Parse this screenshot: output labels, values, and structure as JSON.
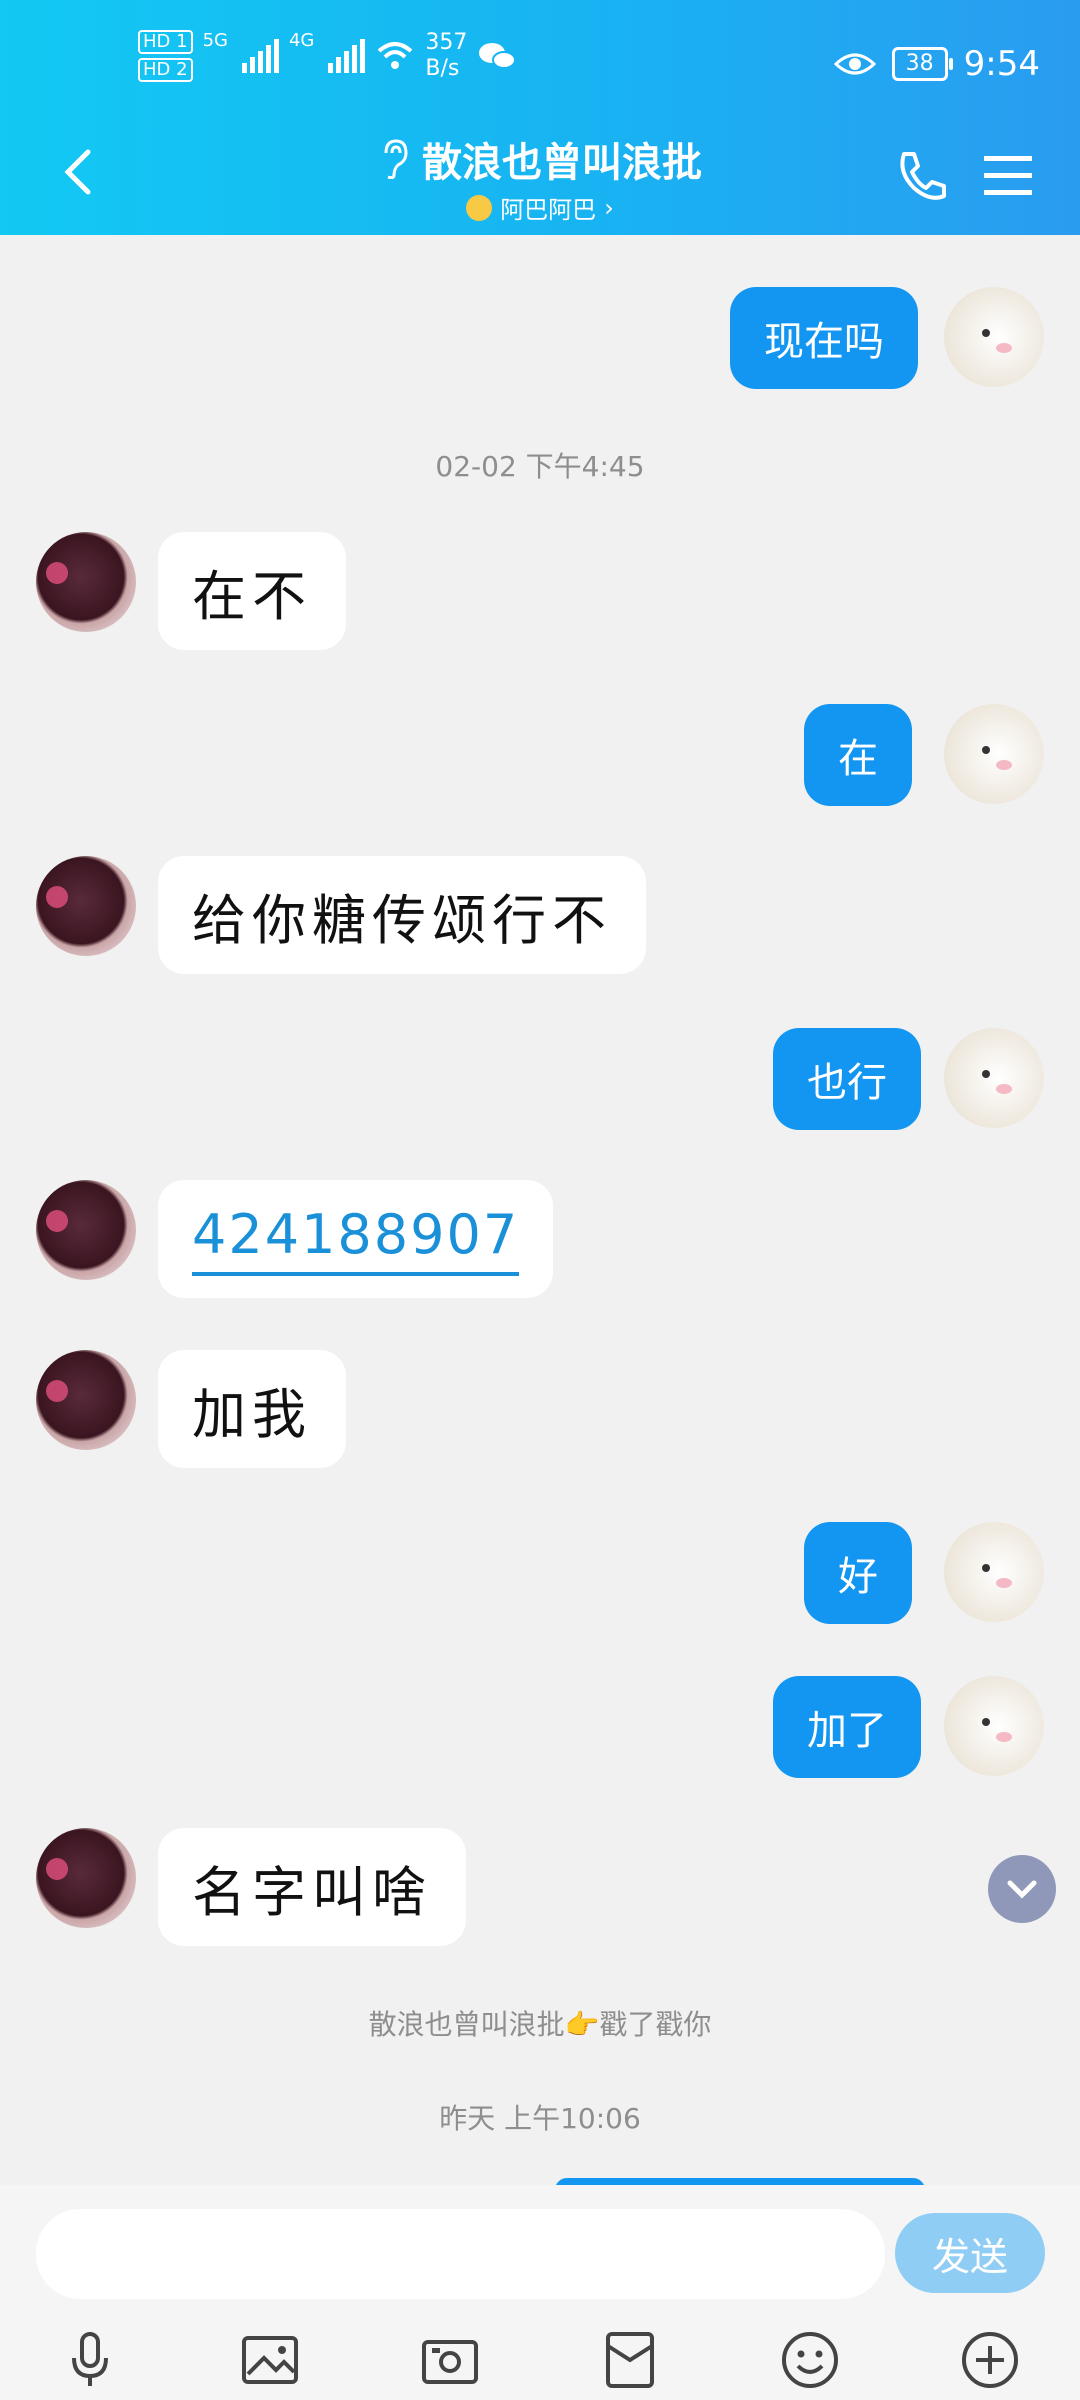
{
  "status_bar": {
    "hd1": "HD 1",
    "hd2": "HD 2",
    "sig1": "5G",
    "sig2": "4G",
    "net_speed_top": "357",
    "net_speed_bottom": "B/s",
    "battery": "38",
    "time": "9:54"
  },
  "header": {
    "title": "散浪也曾叫浪批",
    "subtitle": "阿巴阿巴",
    "subtitle_chevron": "›"
  },
  "messages": [
    {
      "side": "out",
      "text": "现在吗"
    },
    {
      "type": "time",
      "text": "02-02 下午4:45"
    },
    {
      "side": "in",
      "text": "在不"
    },
    {
      "side": "out",
      "text": "在"
    },
    {
      "side": "in",
      "text": "给你糖传颂行不"
    },
    {
      "side": "out",
      "text": "也行"
    },
    {
      "side": "in",
      "text": "424188907",
      "link": true
    },
    {
      "side": "in",
      "text": "加我"
    },
    {
      "side": "out",
      "text": "好"
    },
    {
      "side": "out",
      "text": "加了"
    },
    {
      "side": "in",
      "text": "名字叫啥"
    },
    {
      "type": "system",
      "text": "散浪也曾叫浪批👉戳了戳你"
    },
    {
      "type": "time",
      "text": "昨天 上午10:06"
    }
  ],
  "composer": {
    "input_placeholder": "",
    "send_label": "发送"
  },
  "toolbar_icons": [
    "microphone-icon",
    "photo-icon",
    "camera-icon",
    "red-packet-icon",
    "emoji-icon",
    "plus-icon"
  ],
  "colors": {
    "header_start": "#12c9f3",
    "header_end": "#2a9cf0",
    "outgoing_bubble": "#1396f2",
    "incoming_bubble": "#ffffff",
    "send_button": "#8fcdf5"
  }
}
